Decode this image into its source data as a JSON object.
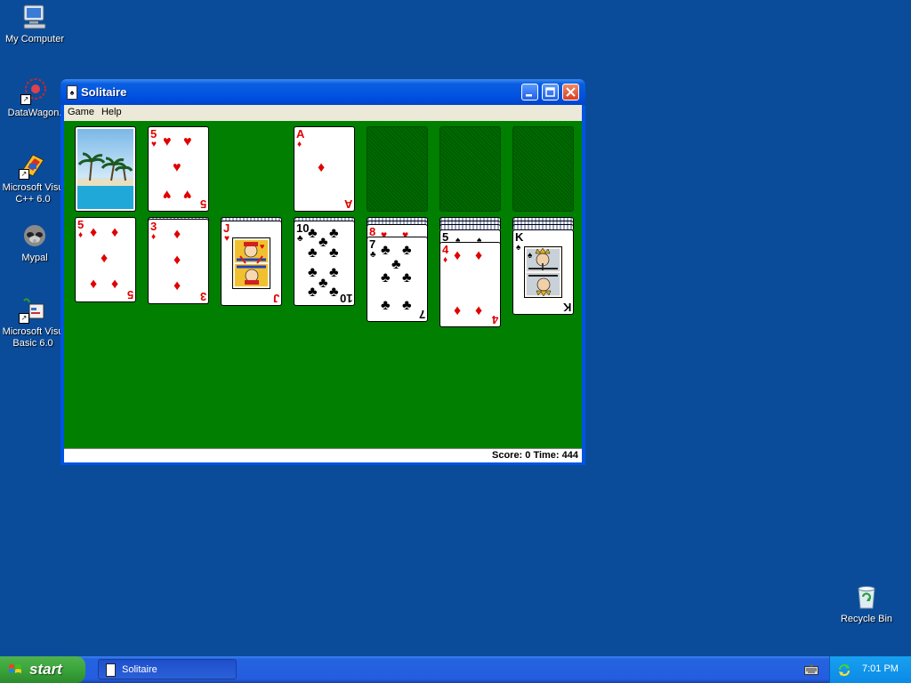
{
  "desktop": {
    "icons": [
      {
        "label": "My Computer"
      },
      {
        "label": "DataWagon."
      },
      {
        "label": "Microsoft Visu C++ 6.0"
      },
      {
        "label": "Mypal"
      },
      {
        "label": "Microsoft Visu Basic 6.0"
      },
      {
        "label": "Recycle Bin"
      }
    ]
  },
  "window": {
    "title": "Solitaire",
    "menu": [
      "Game",
      "Help"
    ],
    "status": "Score: 0 Time: 444",
    "cards": {
      "waste": {
        "rank": "5",
        "suit": "♥"
      },
      "foundation1": {
        "rank": "A",
        "suit": "♦"
      },
      "tableau1": {
        "rank": "5",
        "suit": "♦"
      },
      "tableau2": {
        "rank": "3",
        "suit": "♦"
      },
      "tableau3": {
        "rank": "J",
        "suit": "♥"
      },
      "tableau4": {
        "rank": "10",
        "suit": "♣"
      },
      "tableau5_under": {
        "rank": "8",
        "suit": "♥"
      },
      "tableau5": {
        "rank": "7",
        "suit": "♣"
      },
      "tableau6_under": {
        "rank": "5",
        "suit": "♠"
      },
      "tableau6": {
        "rank": "4",
        "suit": "♦"
      },
      "tableau7": {
        "rank": "K",
        "suit": "♠"
      }
    }
  },
  "taskbar": {
    "start_label": "start",
    "task_label": "Solitaire",
    "clock": "7:01 PM"
  },
  "colors": {
    "desktop": "#0a4c9a",
    "felt": "#007f00",
    "red_suit": "#e00000"
  }
}
